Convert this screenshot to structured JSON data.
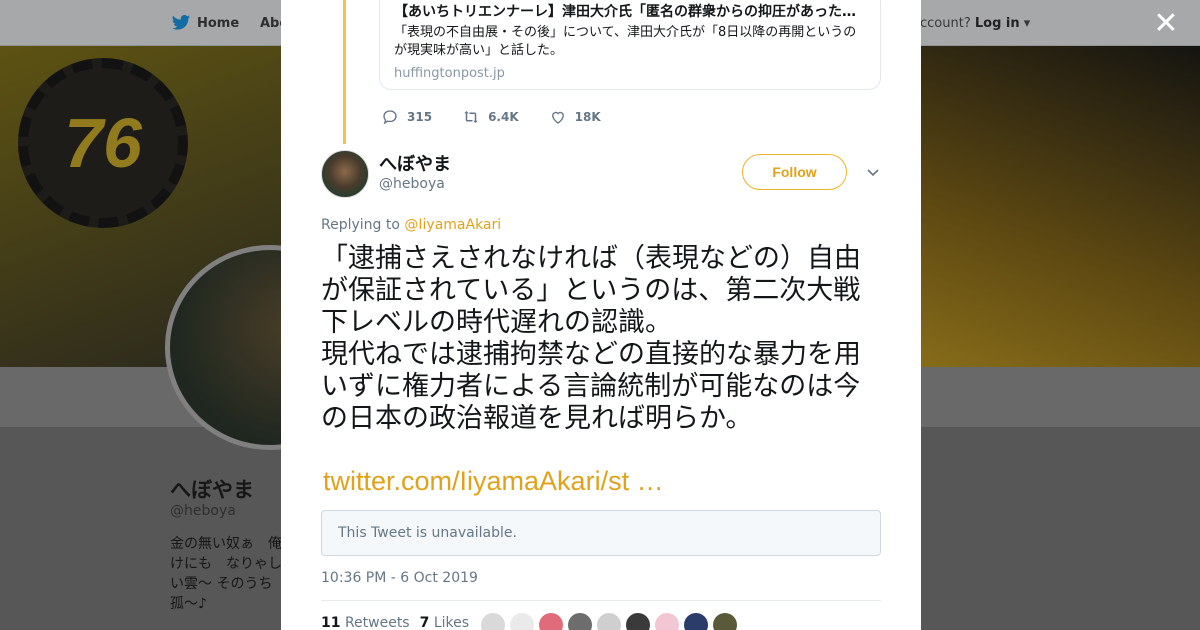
{
  "background": {
    "nav": {
      "home": "Home",
      "about": "Abo",
      "account_prompt": "ccount?",
      "login": "Log in"
    },
    "banner_logo": "76",
    "profile": {
      "name": "へぼやま",
      "handle": "@heboya",
      "bio": "金の無い奴ぁ　俺けにも　なりゃしい雲～ そのうち孤～♪"
    }
  },
  "modal": {
    "card": {
      "title": "【あいちトリエンナーレ】津田大介氏「匿名の群衆からの抑圧があった…",
      "description": "「表現の不自由展・その後」について、津田大介氏が「8日以降の再開というのが現実味が高い」と話した。",
      "domain": "huffingtonpost.jp"
    },
    "actions": {
      "replies": "315",
      "retweets": "6.4K",
      "likes": "18K"
    },
    "author": {
      "name": "へぼやま",
      "handle": "@heboya",
      "follow_label": "Follow"
    },
    "replying": {
      "prefix": "Replying to ",
      "target": "@IiyamaAkari"
    },
    "tweet": {
      "text": "「逮捕さえされなければ（表現などの）自由が保証されている」というのは、第二次大戦下レベルの時代遅れの認識。\n現代ねでは逮捕拘禁などの直接的な暴力を用いずに権力者による言論統制が可能なのは今の日本の政治報道を見れば明らか。",
      "link": "twitter.com/IiyamaAkari/st …"
    },
    "unavailable": "This Tweet is unavailable.",
    "timestamp": "10:36 PM - 6 Oct 2019",
    "stats": {
      "retweets_count": "11",
      "retweets_label": "Retweets",
      "likes_count": "7",
      "likes_label": "Likes"
    },
    "liker_colors": [
      "#d9d9d9",
      "#eaeaea",
      "#e06b7a",
      "#6d6d6d",
      "#cfcfcf",
      "#3a3a3a",
      "#f2c6d2",
      "#2b3b6a",
      "#5a5a3a"
    ]
  },
  "colors": {
    "accent": "#e0a21b",
    "thread": "#f5c542"
  }
}
